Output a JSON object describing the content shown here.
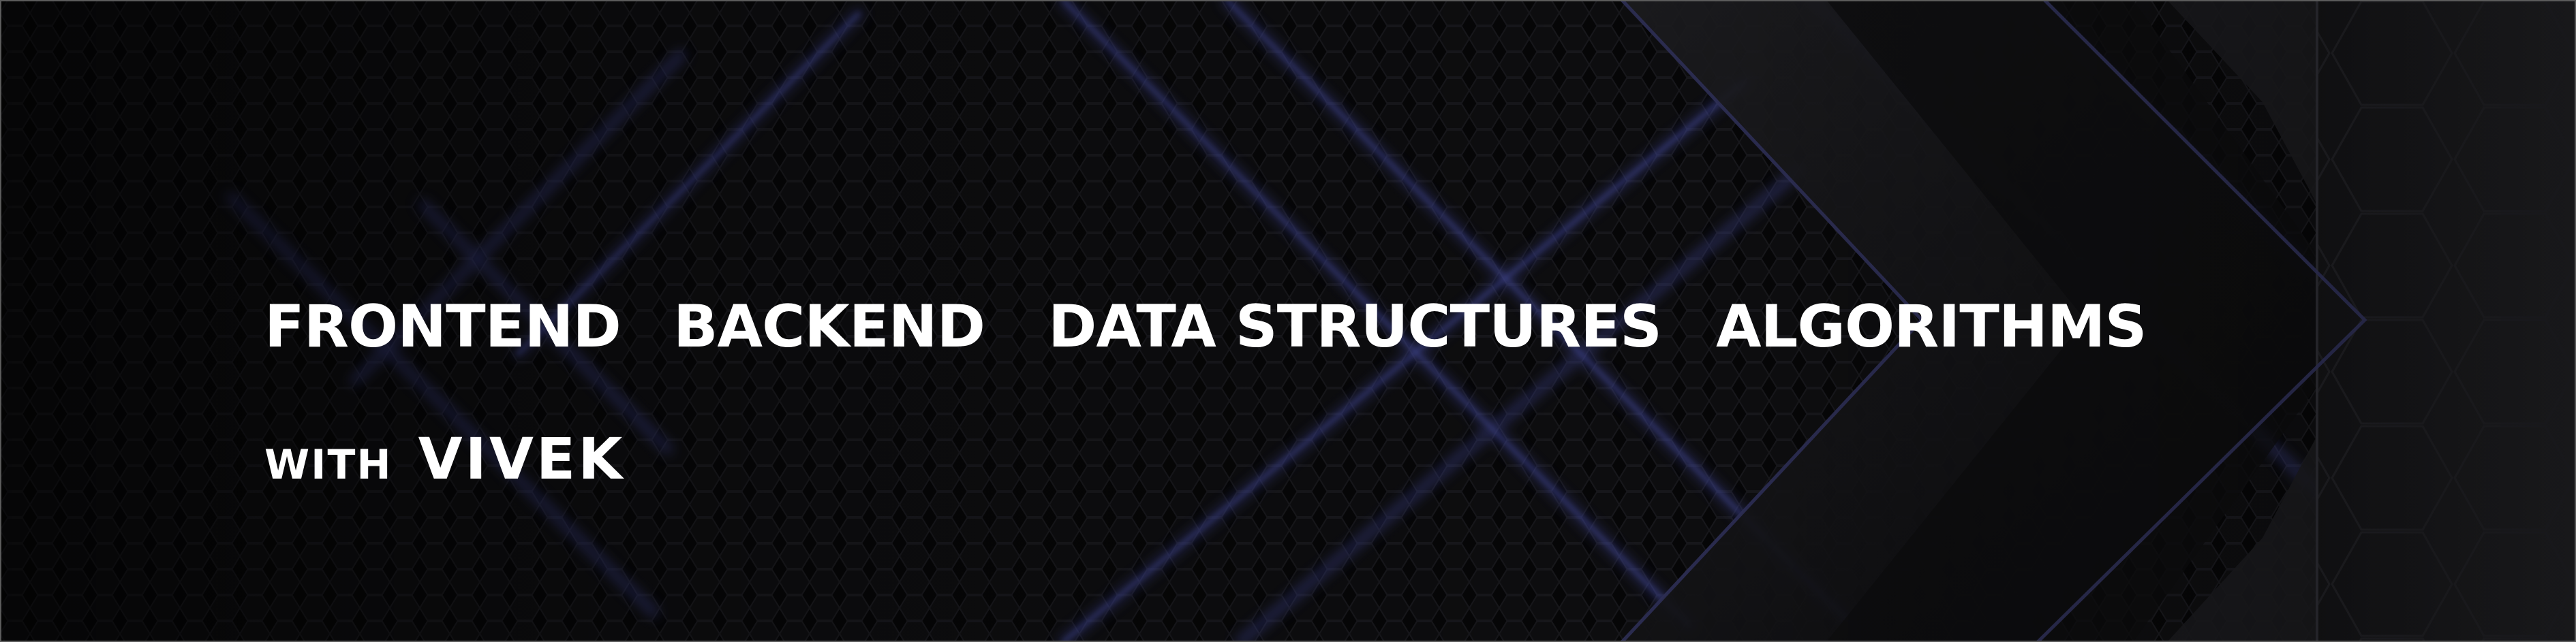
{
  "banner": {
    "topics": [
      "FRONTEND",
      "BACKEND",
      "DATA STRUCTURES",
      "ALGORITHMS"
    ],
    "byline_prefix": "WITH",
    "byline_name": "VIVEK"
  },
  "colors": {
    "background": "#060607",
    "accent_glow": "#3a3f8a",
    "text": "#ffffff"
  }
}
